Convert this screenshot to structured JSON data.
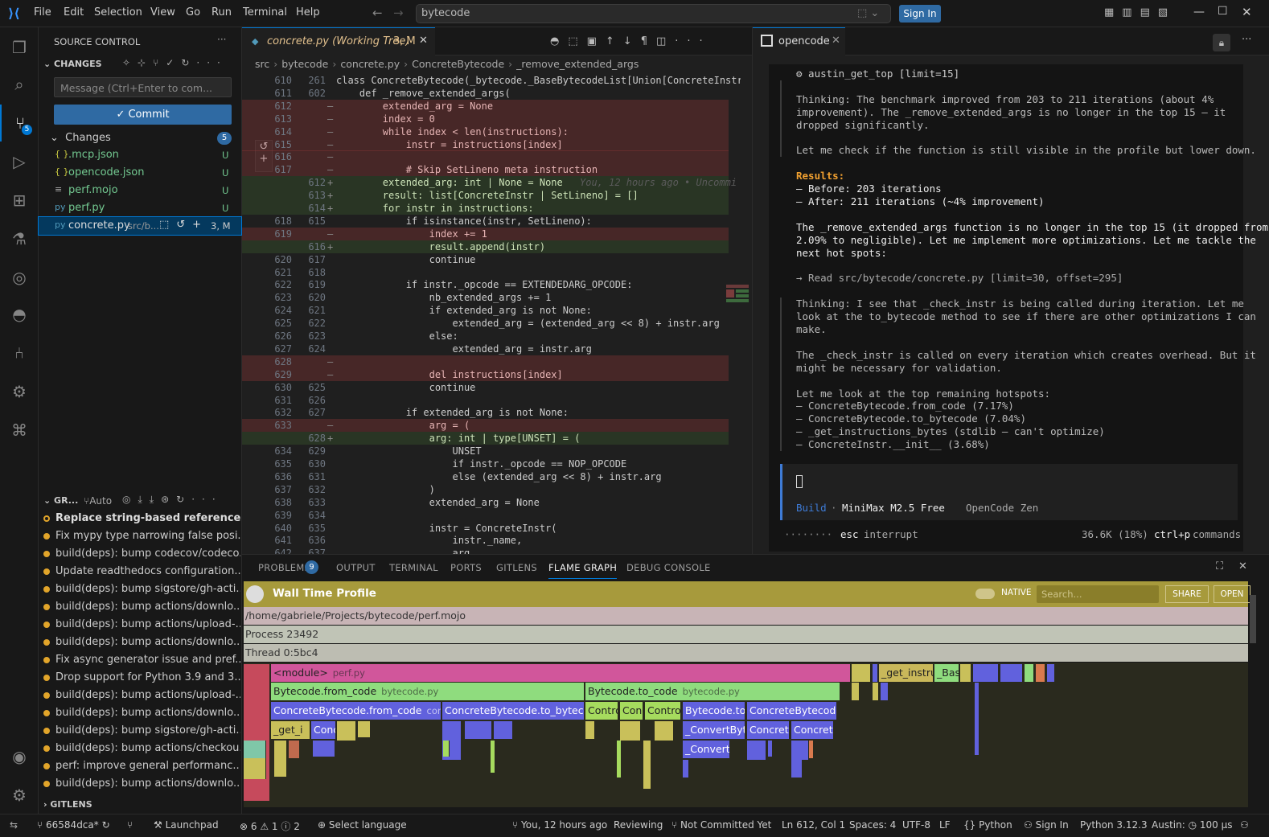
{
  "menu": [
    "File",
    "Edit",
    "Selection",
    "View",
    "Go",
    "Run",
    "Terminal",
    "Help"
  ],
  "search_text": "bytecode",
  "signin": "Sign In",
  "sidebar": {
    "header": "SOURCE CONTROL",
    "changes_header": "CHANGES",
    "message_placeholder": "Message (Ctrl+Enter to com...",
    "commit": "✓ Commit",
    "changes_label": "Changes",
    "changes_count": "5",
    "files": [
      {
        "icon": "{ }",
        "name": ".mcp.json",
        "path": "",
        "status": "U"
      },
      {
        "icon": "{ }",
        "name": "opencode.json",
        "path": "",
        "status": "U"
      },
      {
        "icon": "≡",
        "name": "perf.mojo",
        "path": "",
        "status": "U"
      },
      {
        "icon": "py",
        "name": "perf.py",
        "path": "",
        "status": "U"
      },
      {
        "icon": "py",
        "name": "concrete.py",
        "path": "src/b...",
        "status": "3, M"
      }
    ],
    "graph_header": "GR...",
    "graph_auto": "Auto",
    "commits": [
      "Replace string-based references ...",
      "Fix mypy type narrowing false posi...",
      "build(deps): bump codecov/codeco...",
      "Update readthedocs configuration...",
      "build(deps): bump sigstore/gh-acti...",
      "build(deps): bump actions/downlo...",
      "build(deps): bump actions/upload-...",
      "build(deps): bump actions/downlo...",
      "Fix async generator issue and pref...",
      "Drop support for Python 3.9 and 3...",
      "build(deps): bump actions/upload-...",
      "build(deps): bump actions/downlo...",
      "build(deps): bump sigstore/gh-acti...",
      "build(deps): bump actions/checkou...",
      "perf: improve general performanc...",
      "build(deps): bump actions/downlo..."
    ],
    "gitlens": "GITLENS"
  },
  "editor": {
    "tab_title": "concrete.py (Working Tree)",
    "tab_badge": "3, M",
    "breadcrumb": [
      "src",
      "bytecode",
      "concrete.py",
      "ConcreteBytecode",
      "_remove_extended_args"
    ],
    "blame": "You, 12 hours ago • Uncommi",
    "lines": [
      {
        "a": "610",
        "b": "261",
        "m": "",
        "t": "class ConcreteBytecode(_bytecode._BaseBytecodeList[Union[ConcreteInstr,",
        "k": ""
      },
      {
        "a": "611",
        "b": "602",
        "m": "",
        "t": "    def _remove_extended_args(",
        "k": ""
      },
      {
        "a": "612",
        "b": "",
        "m": "—",
        "t": "        extended_arg = None",
        "k": "del"
      },
      {
        "a": "613",
        "b": "",
        "m": "—",
        "t": "        index = 0",
        "k": "del"
      },
      {
        "a": "614",
        "b": "",
        "m": "—",
        "t": "        while index < len(instructions):",
        "k": "del"
      },
      {
        "a": "615",
        "b": "",
        "m": "—",
        "t": "            instr = instructions[index]",
        "k": "del"
      },
      {
        "a": "616",
        "b": "",
        "m": "—",
        "t": "",
        "k": "del"
      },
      {
        "a": "617",
        "b": "",
        "m": "—",
        "t": "            # Skip SetLineno meta instruction",
        "k": "del"
      },
      {
        "a": "",
        "b": "612",
        "m": "+",
        "t": "        extended_arg: int | None = None",
        "k": "add"
      },
      {
        "a": "",
        "b": "613",
        "m": "+",
        "t": "        result: list[ConcreteInstr | SetLineno] = []",
        "k": "add"
      },
      {
        "a": "",
        "b": "614",
        "m": "+",
        "t": "        for instr in instructions:",
        "k": "add"
      },
      {
        "a": "618",
        "b": "615",
        "m": "",
        "t": "            if isinstance(instr, SetLineno):",
        "k": ""
      },
      {
        "a": "619",
        "b": "",
        "m": "—",
        "t": "                index += 1",
        "k": "del"
      },
      {
        "a": "",
        "b": "616",
        "m": "+",
        "t": "                result.append(instr)",
        "k": "add"
      },
      {
        "a": "620",
        "b": "617",
        "m": "",
        "t": "                continue",
        "k": ""
      },
      {
        "a": "621",
        "b": "618",
        "m": "",
        "t": "",
        "k": ""
      },
      {
        "a": "622",
        "b": "619",
        "m": "",
        "t": "            if instr._opcode == EXTENDEDARG_OPCODE:",
        "k": ""
      },
      {
        "a": "623",
        "b": "620",
        "m": "",
        "t": "                nb_extended_args += 1",
        "k": ""
      },
      {
        "a": "624",
        "b": "621",
        "m": "",
        "t": "                if extended_arg is not None:",
        "k": ""
      },
      {
        "a": "625",
        "b": "622",
        "m": "",
        "t": "                    extended_arg = (extended_arg << 8) + instr.arg",
        "k": ""
      },
      {
        "a": "626",
        "b": "623",
        "m": "",
        "t": "                else:",
        "k": ""
      },
      {
        "a": "627",
        "b": "624",
        "m": "",
        "t": "                    extended_arg = instr.arg",
        "k": ""
      },
      {
        "a": "628",
        "b": "",
        "m": "—",
        "t": "",
        "k": "del"
      },
      {
        "a": "629",
        "b": "",
        "m": "—",
        "t": "                del instructions[index]",
        "k": "del"
      },
      {
        "a": "630",
        "b": "625",
        "m": "",
        "t": "                continue",
        "k": ""
      },
      {
        "a": "631",
        "b": "626",
        "m": "",
        "t": "",
        "k": ""
      },
      {
        "a": "632",
        "b": "627",
        "m": "",
        "t": "            if extended_arg is not None:",
        "k": ""
      },
      {
        "a": "633",
        "b": "",
        "m": "—",
        "t": "                arg = (",
        "k": "del"
      },
      {
        "a": "",
        "b": "628",
        "m": "+",
        "t": "                arg: int | type[UNSET] = (",
        "k": "add"
      },
      {
        "a": "634",
        "b": "629",
        "m": "",
        "t": "                    UNSET",
        "k": ""
      },
      {
        "a": "635",
        "b": "630",
        "m": "",
        "t": "                    if instr._opcode == NOP_OPCODE",
        "k": ""
      },
      {
        "a": "636",
        "b": "631",
        "m": "",
        "t": "                    else (extended_arg << 8) + instr.arg",
        "k": ""
      },
      {
        "a": "637",
        "b": "632",
        "m": "",
        "t": "                )",
        "k": ""
      },
      {
        "a": "638",
        "b": "633",
        "m": "",
        "t": "                extended_arg = None",
        "k": ""
      },
      {
        "a": "639",
        "b": "634",
        "m": "",
        "t": "",
        "k": ""
      },
      {
        "a": "640",
        "b": "635",
        "m": "",
        "t": "                instr = ConcreteInstr(",
        "k": ""
      },
      {
        "a": "641",
        "b": "636",
        "m": "",
        "t": "                    instr._name,",
        "k": ""
      },
      {
        "a": "642",
        "b": "637",
        "m": "",
        "t": "                    arg,",
        "k": ""
      }
    ]
  },
  "chat": {
    "tab_title": "opencode",
    "lines": [
      {
        "t": "⚙ austin_get_top [limit=15]",
        "c": "#ccc",
        "bar": false
      },
      {
        "t": "",
        "c": "#ccc",
        "bar": true
      },
      {
        "t": "Thinking: The benchmark improved from 203 to 211 iterations (about 4%",
        "c": "#bbb",
        "bar": true
      },
      {
        "t": "improvement). The _remove_extended_args is no longer in the top 15 – it",
        "c": "#bbb",
        "bar": true
      },
      {
        "t": "dropped significantly.",
        "c": "#bbb",
        "bar": true
      },
      {
        "t": "",
        "c": "#bbb",
        "bar": true
      },
      {
        "t": "Let me check if the function is still visible in the profile but lower down.",
        "c": "#bbb",
        "bar": true
      },
      {
        "t": "",
        "c": "#bbb",
        "bar": false
      },
      {
        "t": "Results:",
        "c": "#f0a030",
        "bar": false
      },
      {
        "t": "– Before: 203 iterations",
        "c": "#eee",
        "bar": false
      },
      {
        "t": "– After: 211 iterations (~4% improvement)",
        "c": "#eee",
        "bar": false
      },
      {
        "t": "",
        "c": "#eee",
        "bar": false
      },
      {
        "t": "The _remove_extended_args function is no longer in the top 15 (it dropped from",
        "c": "#eee",
        "bar": false
      },
      {
        "t": "2.09% to negligible). Let me implement more optimizations. Let me tackle the",
        "c": "#eee",
        "bar": false
      },
      {
        "t": "next hot spots:",
        "c": "#eee",
        "bar": false
      },
      {
        "t": "",
        "c": "#eee",
        "bar": false
      },
      {
        "t": "→ Read src/bytecode/concrete.py [limit=30, offset=295]",
        "c": "#aaa",
        "bar": false
      },
      {
        "t": "",
        "c": "#aaa",
        "bar": false
      },
      {
        "t": "Thinking: I see that _check_instr is being called during iteration. Let me",
        "c": "#bbb",
        "bar": true
      },
      {
        "t": "look at the to_bytecode method to see if there are other optimizations I can",
        "c": "#bbb",
        "bar": true
      },
      {
        "t": "make.",
        "c": "#bbb",
        "bar": true
      },
      {
        "t": "",
        "c": "#bbb",
        "bar": true
      },
      {
        "t": "The _check_instr is called on every iteration which creates overhead. But it",
        "c": "#bbb",
        "bar": true
      },
      {
        "t": "might be necessary for validation.",
        "c": "#bbb",
        "bar": true
      },
      {
        "t": "",
        "c": "#bbb",
        "bar": true
      },
      {
        "t": "Let me look at the top remaining hotspots:",
        "c": "#bbb",
        "bar": true
      },
      {
        "t": "– ConcreteBytecode.from_code (7.17%)",
        "c": "#bbb",
        "bar": true
      },
      {
        "t": "– ConcreteBytecode.to_bytecode (7.04%)",
        "c": "#bbb",
        "bar": true
      },
      {
        "t": "– _get_instructions_bytes (stdlib – can't optimize)",
        "c": "#bbb",
        "bar": true
      },
      {
        "t": "– ConcreteInstr.__init__ (3.68%)",
        "c": "#bbb",
        "bar": true
      }
    ],
    "input_mode": "Build",
    "model": "MiniMax M2.5 Free",
    "provider": "OpenCode Zen",
    "footer_dots": "········",
    "esc": "esc",
    "interrupt": "interrupt",
    "tokens": "36.6K (18%)",
    "shortcut": "ctrl+p",
    "commands": "commands"
  },
  "panel": {
    "tabs": [
      "PROBLEMS",
      "OUTPUT",
      "TERMINAL",
      "PORTS",
      "GITLENS",
      "FLAME GRAPH",
      "DEBUG CONSOLE"
    ],
    "problems_badge": "9",
    "active_tab": "FLAME GRAPH",
    "flame_title": "Wall Time Profile",
    "native": "NATIVE",
    "search_placeholder": "Search...",
    "share": "SHARE",
    "open": "OPEN",
    "rows": [
      "/home/gabriele/Projects/bytecode/perf.mojo",
      "Process 23492",
      "Thread 0:5bc4"
    ],
    "frames": [
      {
        "t": "<module>",
        "f": "perf.py"
      },
      {
        "t": "Bytecode.from_code",
        "f": "bytecode.py"
      },
      {
        "t": "Bytecode.to_code",
        "f": "bytecode.py"
      },
      {
        "t": "ConcreteBytecode.from_code",
        "f": "conc"
      },
      {
        "t": "ConcreteBytecode.to_bytecode",
        "f": ""
      },
      {
        "t": "Contro",
        "f": ""
      },
      {
        "t": "Con",
        "f": ""
      },
      {
        "t": "Contro",
        "f": ""
      },
      {
        "t": "Bytecode.to_",
        "f": ""
      },
      {
        "t": "ConcreteBytecode",
        "f": ""
      },
      {
        "t": "_get_i",
        "f": ""
      },
      {
        "t": "Conc",
        "f": ""
      },
      {
        "t": "_ConvertByte",
        "f": ""
      },
      {
        "t": "Concret",
        "f": ""
      },
      {
        "t": "Concret",
        "f": ""
      },
      {
        "t": "_Convert",
        "f": ""
      },
      {
        "t": "_get_instru",
        "f": ""
      },
      {
        "t": "_Bas",
        "f": ""
      }
    ]
  },
  "status": {
    "branch": "66584dca*",
    "launchpad": "Launchpad",
    "errors": "6",
    "warnings": "1",
    "infos": "2",
    "language_select": "Select language",
    "blame": "You, 12 hours ago",
    "reviewing": "Reviewing",
    "committed": "Not Committed Yet",
    "position": "Ln 612, Col 1",
    "spaces": "Spaces: 4",
    "encoding": "UTF-8",
    "eol": "LF",
    "language": "Python",
    "signin": "Sign In",
    "interpreter": "Python 3.12.3",
    "austin": "Austin:",
    "austin_val": "100 μs"
  }
}
